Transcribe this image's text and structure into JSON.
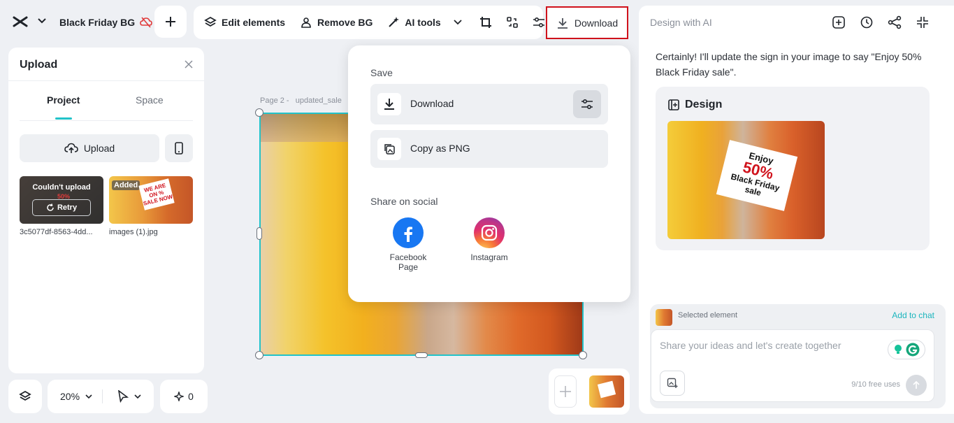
{
  "header": {
    "project_name": "Black Friday BG"
  },
  "toolbar": {
    "edit_elements": "Edit elements",
    "remove_bg": "Remove BG",
    "ai_tools": "AI tools",
    "download": "Download"
  },
  "upload_panel": {
    "title": "Upload",
    "tabs": [
      "Project",
      "Space"
    ],
    "upload_button": "Upload",
    "items": [
      {
        "filename": "3c5077df-8563-4dd...",
        "status": "Couldn't upload",
        "overlay_text": "50%",
        "action": "Retry"
      },
      {
        "filename": "images (1).jpg",
        "status": "Added",
        "sign_text": "WE ARE ON % SALE NOW"
      }
    ]
  },
  "bottom_controls": {
    "zoom": "20%",
    "ai_count": "0"
  },
  "canvas": {
    "page_label": "Page 2 -",
    "page_name": "updated_sale"
  },
  "download_popup": {
    "save_label": "Save",
    "download_label": "Download",
    "copy_label": "Copy as PNG",
    "share_label": "Share on social",
    "social": [
      {
        "name": "Facebook Page",
        "line1": "Facebook",
        "line2": "Page"
      },
      {
        "name": "Instagram",
        "line1": "Instagram",
        "line2": ""
      }
    ]
  },
  "ai_panel": {
    "title": "Design with AI",
    "message": "Certainly! I'll update the sign in your image to say \"Enjoy 50% Black Friday sale\".",
    "design_card_title": "Design",
    "design_sign": {
      "line1": "Enjoy",
      "line2": "50%",
      "line3": "Black Friday",
      "line4": "sale"
    },
    "selected_element_label": "Selected element",
    "add_to_chat": "Add to chat",
    "input_placeholder": "Share your ideas and let's create together",
    "free_uses": "9/10 free uses"
  },
  "colors": {
    "accent": "#22c3c9",
    "highlight_border": "#d0121c",
    "facebook": "#1877f2"
  }
}
